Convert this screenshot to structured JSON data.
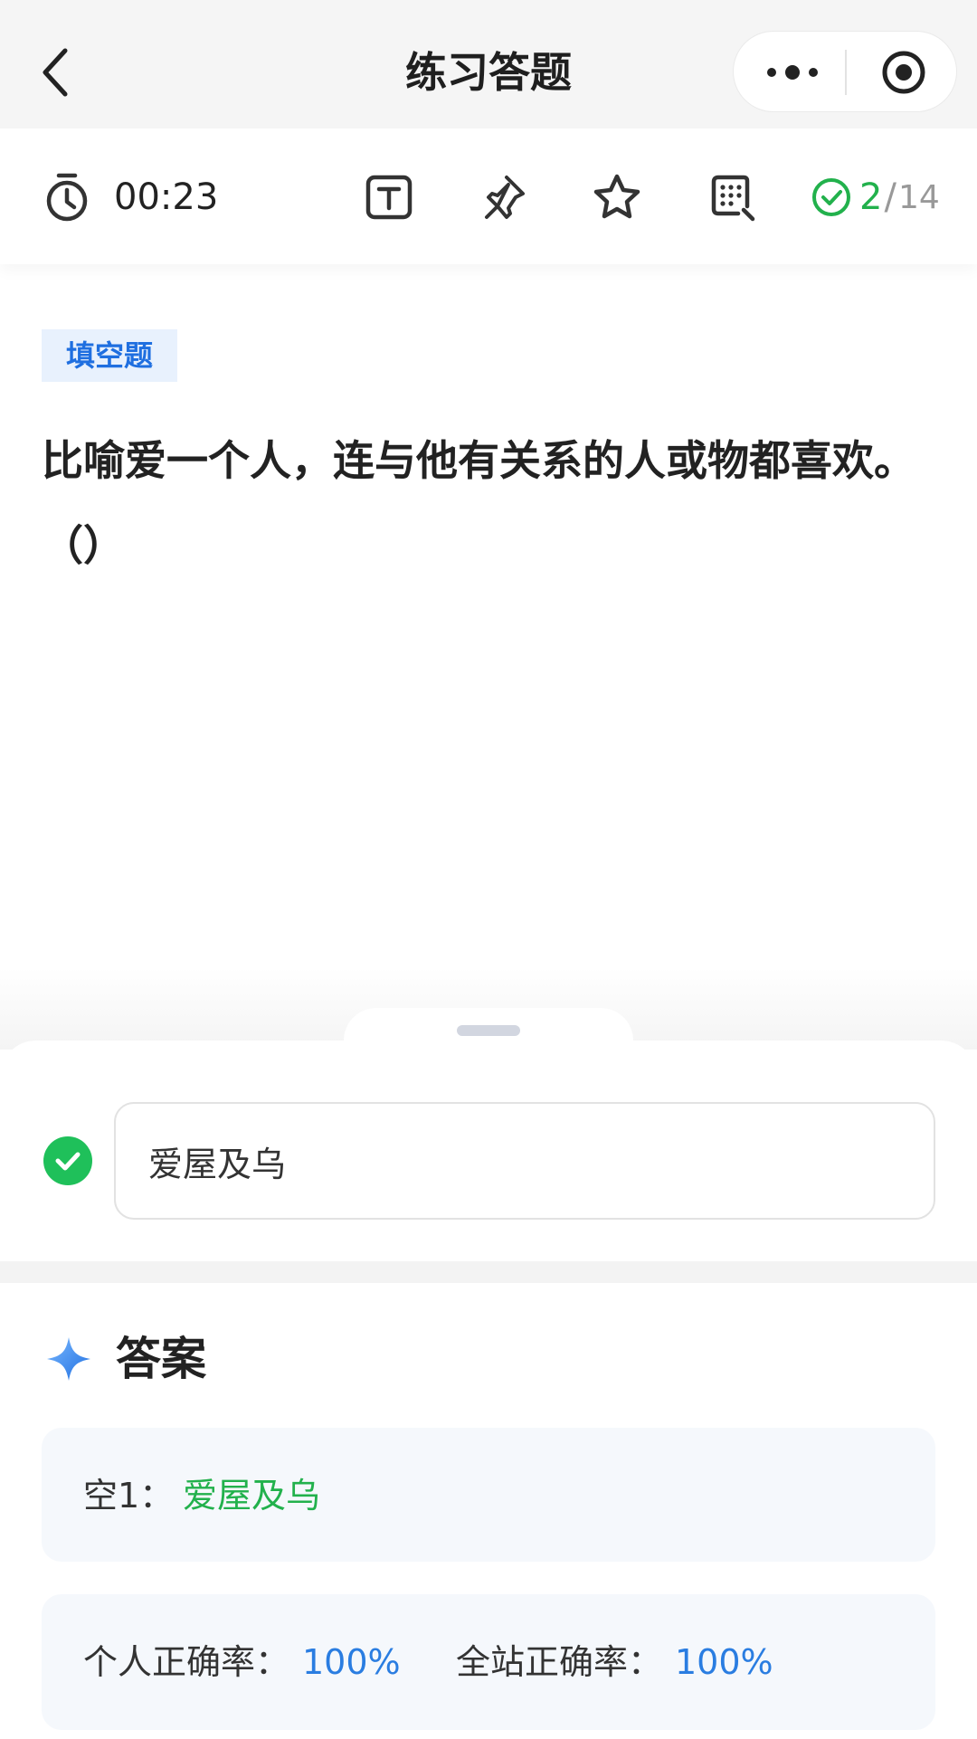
{
  "nav": {
    "title": "练习答题"
  },
  "toolbar": {
    "timer": "00:23",
    "progress_current": "2",
    "progress_separator": "/",
    "progress_total": "14"
  },
  "icons": {
    "back": "chevron-left-icon",
    "more": "more-dots-icon",
    "close": "target-circle-icon",
    "timer": "stopwatch-icon",
    "text_size": "text-size-icon",
    "pin": "pin-icon",
    "favorite": "star-icon",
    "answer_sheet": "answer-sheet-icon",
    "progress": "check-circle-icon",
    "answer_correct": "check-filled-icon",
    "answer_heading": "sparkle-icon"
  },
  "question": {
    "type_tag": "填空题",
    "text": "比喻爱一个人，连与他有关系的人或物都喜欢。（）"
  },
  "user_answer": {
    "value": "爱屋及乌",
    "status": "correct"
  },
  "answer": {
    "heading": "答案",
    "blank_label": "空1：",
    "blank_value": "爱屋及乌",
    "personal_accuracy_label": "个人正确率：",
    "personal_accuracy_value": "100%",
    "site_accuracy_label": "全站正确率：",
    "site_accuracy_value": "100%"
  },
  "colors": {
    "accent_blue": "#1f6fe0",
    "correct_green": "#22b14c",
    "stat_blue": "#2a7de1",
    "tag_bg": "#e8f1fd",
    "card_bg": "#f5f8fc"
  }
}
